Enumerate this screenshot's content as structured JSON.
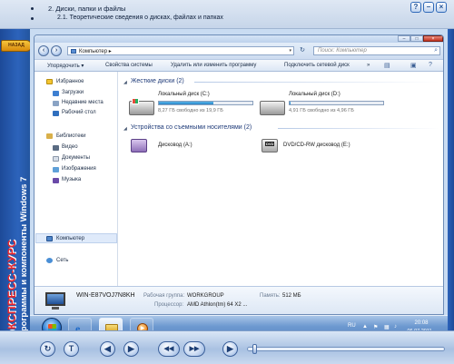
{
  "course": {
    "chapter": "2. Диски, папки и файлы",
    "section": "2.1. Теоретические сведения о дисках, файлах и папках",
    "back_tab": "НАЗАД",
    "brand": "ЭКСПРЕСС-КУРС",
    "course_title": "Программы и компоненты Windows 7",
    "header_buttons": [
      "?",
      "–",
      "×"
    ]
  },
  "explorer": {
    "window_buttons": [
      "–",
      "□",
      "×"
    ],
    "address": {
      "location": "Компьютер",
      "separator": "▸"
    },
    "search": {
      "placeholder": "Поиск: Компьютер"
    },
    "commands": [
      "Упорядочить ▾",
      "Свойства системы",
      "Удалить или изменить программу",
      "Подключить сетевой диск",
      "»"
    ],
    "nav": {
      "favorites_label": "Избранное",
      "favorites": [
        "Загрузки",
        "Недавние места",
        "Рабочий стол"
      ],
      "libraries_label": "Библиотеки",
      "libraries": [
        "Видео",
        "Документы",
        "Изображения",
        "Музыка"
      ],
      "computer": "Компьютер",
      "network": "Сеть"
    },
    "hard_disks": {
      "title": "Жесткие диски (2)",
      "drives": [
        {
          "name": "Локальный диск (C:)",
          "free": "8,27 ГБ свободно из 19,9 ГБ",
          "used_fraction": 0.58
        },
        {
          "name": "Локальный диск (D:)",
          "free": "4,91 ГБ свободно из 4,96 ГБ",
          "used_fraction": 0.01
        }
      ]
    },
    "removable": {
      "title": "Устройства со съемными носителями (2)",
      "devices": [
        {
          "name": "Дисковод (A:)"
        },
        {
          "name": "DVD/CD-RW дисковод (E:)",
          "badge": "DVD"
        }
      ]
    },
    "details": {
      "pc_name": "WIN-E87VOJ7N8KH",
      "workgroup_label": "Рабочая группа:",
      "workgroup": "WORKGROUP",
      "memory_label": "Память:",
      "memory": "512 МБ",
      "cpu_label": "Процессор:",
      "cpu": "AMD Athlon(tm) 64 X2 ..."
    }
  },
  "taskbar": {
    "language": "RU",
    "time": "20:08",
    "date": "06.07.2011"
  },
  "player": {
    "buttons": [
      "↻",
      "T",
      "◀",
      "▶",
      "◀◀",
      "▶▶",
      "▶"
    ]
  }
}
